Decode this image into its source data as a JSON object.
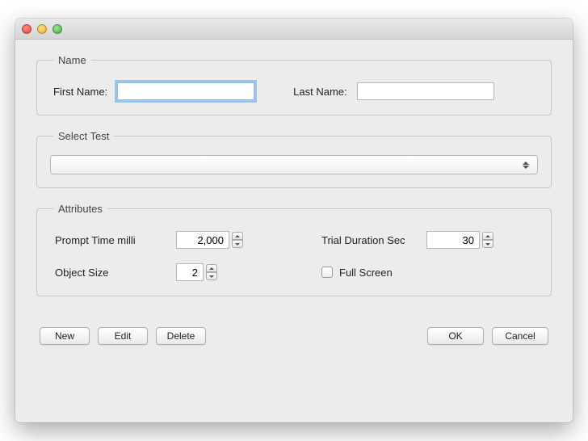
{
  "groups": {
    "name": "Name",
    "selectTest": "Select Test",
    "attributes": "Attributes"
  },
  "name": {
    "firstLabel": "First Name:",
    "firstValue": "",
    "lastLabel": "Last Name:",
    "lastValue": ""
  },
  "selectTest": {
    "selected": ""
  },
  "attributes": {
    "promptTimeLabel": "Prompt Time milli",
    "promptTimeValue": "2,000",
    "trialDurationLabel": "Trial Duration Sec",
    "trialDurationValue": "30",
    "objectSizeLabel": "Object Size",
    "objectSizeValue": "2",
    "fullScreenLabel": "Full Screen",
    "fullScreenChecked": false
  },
  "buttons": {
    "new": "New",
    "edit": "Edit",
    "delete": "Delete",
    "ok": "OK",
    "cancel": "Cancel"
  }
}
